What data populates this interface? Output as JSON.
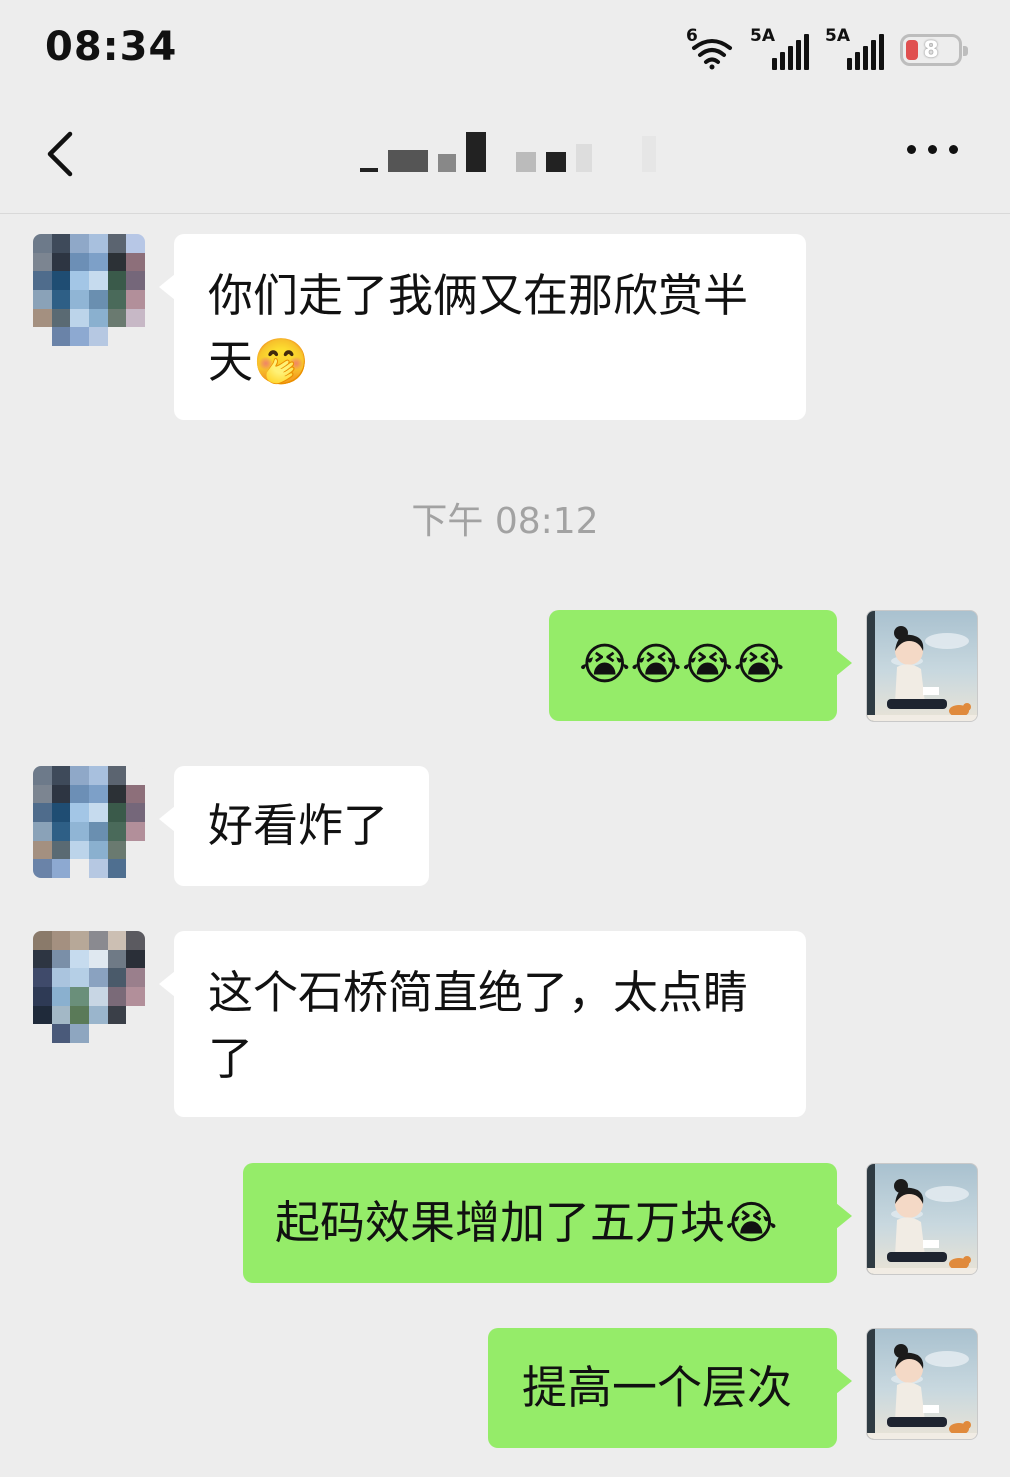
{
  "status_bar": {
    "time": "08:34",
    "wifi_label": "6",
    "sim1_label": "5A",
    "sim2_label": "5A",
    "battery_level": "8"
  },
  "nav": {
    "back_icon": "chevron-left-icon",
    "more_icon": "more-dots-icon"
  },
  "timestamp": "下午 08:12",
  "messages": [
    {
      "side": "left",
      "text": "你们走了我俩又在那欣赏半天🤭"
    },
    {
      "side": "right",
      "text": "😭😭😭😭"
    },
    {
      "side": "left",
      "text": "好看炸了"
    },
    {
      "side": "left",
      "text": "这个石桥简直绝了，太点睛了"
    },
    {
      "side": "right",
      "text": "起码效果增加了五万块😭"
    },
    {
      "side": "right",
      "text": "提高一个层次"
    }
  ],
  "colors": {
    "background": "#ededed",
    "incoming_bubble": "#ffffff",
    "outgoing_bubble": "#95ec69",
    "timestamp_text": "#a2a2a2"
  }
}
